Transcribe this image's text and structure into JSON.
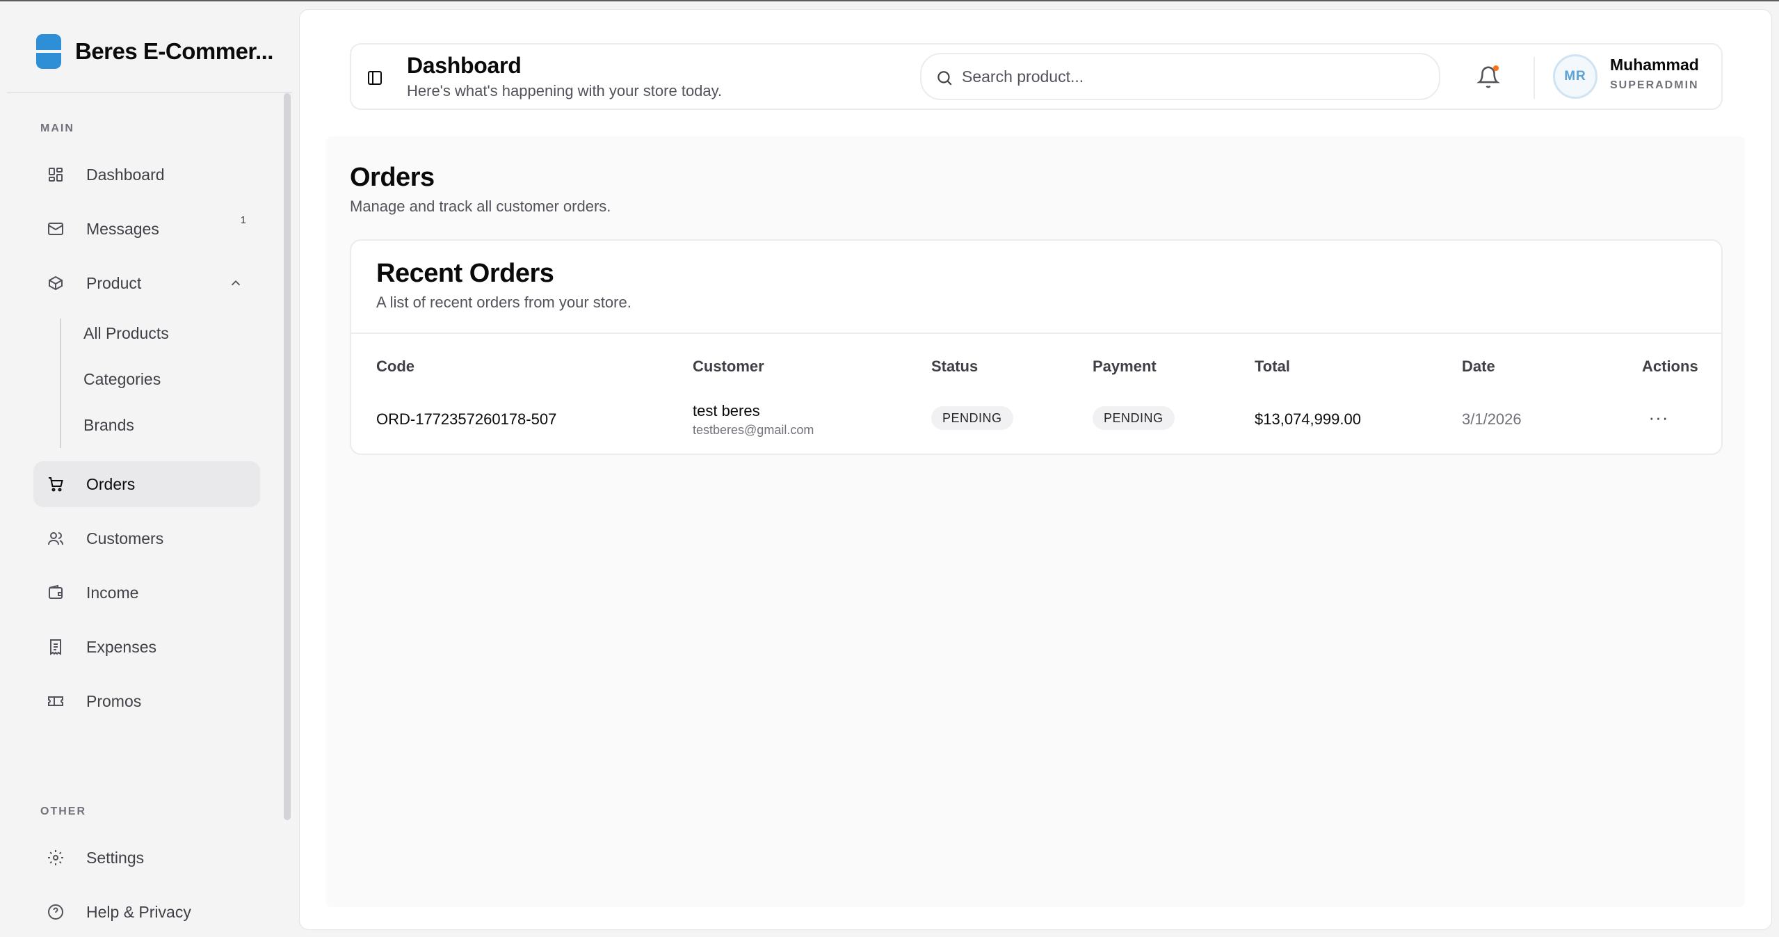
{
  "app": {
    "name": "Beres E-Commer..."
  },
  "sidebar": {
    "main_label": "MAIN",
    "other_label": "OTHER",
    "items": [
      {
        "label": "Dashboard",
        "icon": "grid-icon"
      },
      {
        "label": "Messages",
        "icon": "mail-icon",
        "badge": "1"
      },
      {
        "label": "Product",
        "icon": "package-icon",
        "expanded": true
      },
      {
        "label": "Orders",
        "icon": "cart-icon",
        "active": true
      },
      {
        "label": "Customers",
        "icon": "users-icon"
      },
      {
        "label": "Income",
        "icon": "wallet-icon"
      },
      {
        "label": "Expenses",
        "icon": "receipt-icon"
      },
      {
        "label": "Promos",
        "icon": "ticket-icon"
      }
    ],
    "product_subitems": [
      "All Products",
      "Categories",
      "Brands"
    ],
    "other_items": [
      {
        "label": "Settings",
        "icon": "gear-icon"
      },
      {
        "label": "Help & Privacy",
        "icon": "help-icon"
      }
    ]
  },
  "header": {
    "title": "Dashboard",
    "subtitle": "Here's what's happening with your store today.",
    "search_placeholder": "Search product...",
    "user": {
      "initials": "MR",
      "name": "Muhammad",
      "role": "SUPERADMIN"
    }
  },
  "page": {
    "title": "Orders",
    "subtitle": "Manage and track all customer orders."
  },
  "orders_card": {
    "title": "Recent Orders",
    "subtitle": "A list of recent orders from your store.",
    "columns": [
      "Code",
      "Customer",
      "Status",
      "Payment",
      "Total",
      "Date",
      "Actions"
    ],
    "rows": [
      {
        "code": "ORD-1772357260178-507",
        "customer_name": "test beres",
        "customer_email": "testberes@gmail.com",
        "status": "PENDING",
        "payment": "PENDING",
        "total": "$13,074,999.00",
        "date": "3/1/2026",
        "actions": "···"
      }
    ]
  },
  "colors": {
    "brand": "#2e8fd6",
    "notification_dot": "#f97316",
    "avatar_text": "#5ba2d6"
  }
}
